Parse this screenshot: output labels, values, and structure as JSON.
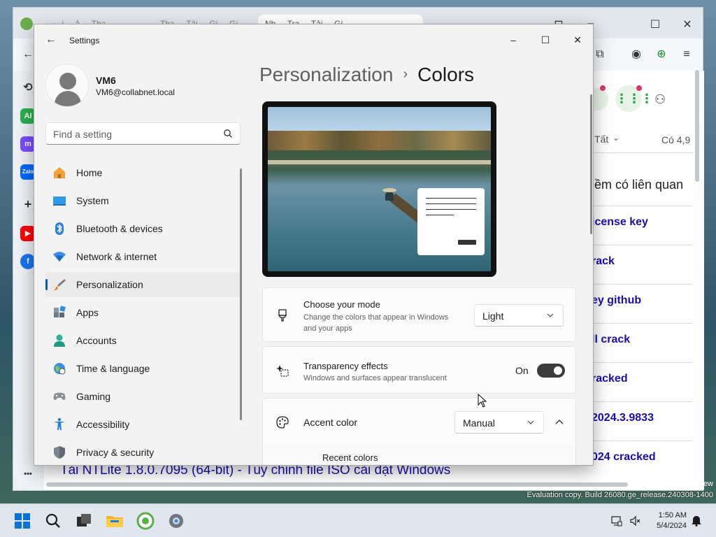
{
  "browser": {
    "tabs": [
      {
        "label": "⋯ i ... ả ... Tha ... "
      },
      {
        "label": "Tha ... Tải ... Gi ... Gi ... "
      },
      {
        "label": "Nh ... Tra ... Tải ... Gi ... "
      }
    ],
    "page": {
      "filter_label": "Tất",
      "count_label": "Có 4,9",
      "related_heading": "iềm có liên quan",
      "results": [
        "icense key",
        "rack",
        "ey github",
        "ll crack",
        "racked",
        "2024.3.9833",
        "024 cracked"
      ],
      "bottom_title": "Tải NTLite 1.8.0.7095 (64-bit) - Tùy chỉnh file ISO cài đặt Windows"
    }
  },
  "settings": {
    "app_title": "Settings",
    "profile": {
      "name": "VM6",
      "email": "VM6@collabnet.local"
    },
    "search": {
      "placeholder": "Find a setting"
    },
    "nav": [
      {
        "label": "Home",
        "icon": "home-icon"
      },
      {
        "label": "System",
        "icon": "system-icon"
      },
      {
        "label": "Bluetooth & devices",
        "icon": "bluetooth-icon"
      },
      {
        "label": "Network & internet",
        "icon": "wifi-icon"
      },
      {
        "label": "Personalization",
        "icon": "brush-icon",
        "selected": true
      },
      {
        "label": "Apps",
        "icon": "apps-icon"
      },
      {
        "label": "Accounts",
        "icon": "account-icon"
      },
      {
        "label": "Time & language",
        "icon": "globe-clock-icon"
      },
      {
        "label": "Gaming",
        "icon": "gamepad-icon"
      },
      {
        "label": "Accessibility",
        "icon": "accessibility-icon"
      },
      {
        "label": "Privacy & security",
        "icon": "shield-icon"
      }
    ],
    "breadcrumb": {
      "parent": "Personalization",
      "separator": "›",
      "current": "Colors"
    },
    "mode": {
      "title": "Choose your mode",
      "description": "Change the colors that appear in Windows and your apps",
      "value": "Light"
    },
    "transparency": {
      "title": "Transparency effects",
      "description": "Windows and surfaces appear translucent",
      "state_label": "On",
      "enabled": true
    },
    "accent": {
      "title": "Accent color",
      "value": "Manual",
      "expanded": true
    },
    "recent_colors_label": "Recent colors"
  },
  "taskbar": {
    "time": "1:50 AM",
    "date": "5/4/2024"
  },
  "watermark": {
    "line1": "ew",
    "line2": "Evaluation copy. Build 26080.ge_release.240308-1400"
  },
  "colors": {
    "accent": "#005fb8",
    "window_bg": "#f3f3f3"
  }
}
